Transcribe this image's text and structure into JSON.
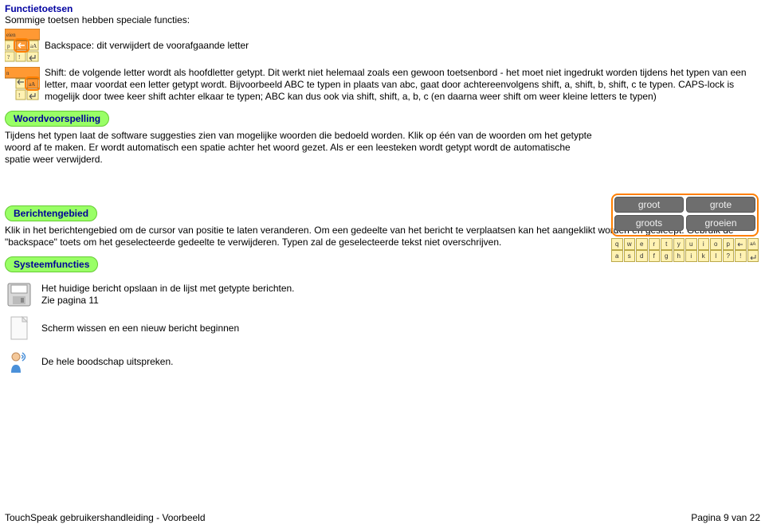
{
  "title": "Functietoetsen",
  "intro": "Sommige toetsen hebben speciale functies:",
  "backspace_text": "Backspace: dit verwijdert de voorafgaande letter",
  "shift_text": "Shift: de volgende letter wordt als hoofdletter getypt. Dit werkt niet helemaal zoals een gewoon toetsenbord - het moet niet ingedrukt worden tijdens het typen van een letter, maar voordat een letter getypt wordt. Bijvoorbeeld ABC te typen in plaats van abc, gaat door achtereenvolgens shift, a, shift, b, shift, c te typen. CAPS-lock is mogelijk door twee keer shift achter elkaar te typen; ABC kan dus ook via shift, shift, a, b, c (en daarna weer shift om weer kleine letters te typen)",
  "headings": {
    "woordvoorspelling": "Woordvoorspelling",
    "berichtengebied": "Berichtengebied",
    "systeemfuncties": "Systeemfuncties"
  },
  "woord_text": "Tijdens het typen laat de software suggesties zien van mogelijke woorden die bedoeld worden. Klik op één van de woorden om het getypte woord af te maken. Er wordt automatisch een spatie achter het woord gezet. Als er een leesteken wordt getypt wordt de automatische spatie weer verwijderd.",
  "suggestions": {
    "a": "groot",
    "b": "grote",
    "c": "groots",
    "d": "groeien"
  },
  "kbd_row1": [
    "q",
    "w",
    "e",
    "r",
    "t",
    "y",
    "u",
    "i",
    "o",
    "p"
  ],
  "kbd_row2": [
    "a",
    "s",
    "d",
    "f",
    "g",
    "h",
    "i",
    "k",
    "l",
    "?"
  ],
  "bericht_text": "Klik in het berichtengebied om de cursor van positie te laten veranderen. Om een gedeelte van het bericht te verplaatsen kan het aangeklikt worden en gesleept. Gebruik de \"backspace\" toets om het geselecteerde gedeelte te verwijderen. Typen zal de geselecteerde tekst niet overschrijven.",
  "sys": {
    "save_l1": "Het huidige bericht opslaan in de lijst met getypte berichten.",
    "save_l2": "Zie pagina 11",
    "clear": "Scherm wissen en een nieuw bericht beginnen",
    "speak": "De hele boodschap uitspreken."
  },
  "footer": {
    "left": "TouchSpeak gebruikershandleiding - Voorbeeld",
    "right": "Pagina 9 van 22"
  },
  "mini_labels": {
    "eien": "eien",
    "n": "n"
  }
}
